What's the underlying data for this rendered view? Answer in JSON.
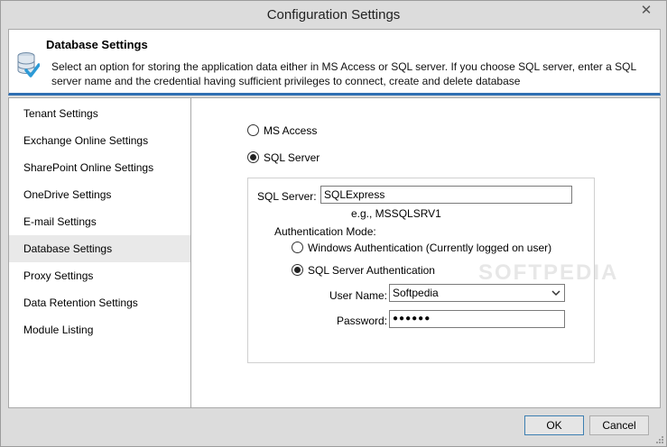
{
  "window": {
    "title": "Configuration Settings",
    "close_glyph": "✕"
  },
  "header": {
    "title": "Database Settings",
    "description": "Select an option for storing the application data either in MS Access or SQL server. If you choose SQL server, enter a SQL server name and the credential having sufficient privileges to connect, create and delete database",
    "icon": "database-check-icon"
  },
  "sidebar": {
    "items": [
      {
        "label": "Tenant Settings",
        "active": false
      },
      {
        "label": "Exchange Online Settings",
        "active": false
      },
      {
        "label": "SharePoint Online Settings",
        "active": false
      },
      {
        "label": "OneDrive Settings",
        "active": false
      },
      {
        "label": "E-mail Settings",
        "active": false
      },
      {
        "label": "Database Settings",
        "active": true
      },
      {
        "label": "Proxy Settings",
        "active": false
      },
      {
        "label": "Data Retention Settings",
        "active": false
      },
      {
        "label": "Module Listing",
        "active": false
      }
    ]
  },
  "storage": {
    "ms_access_label": "MS Access",
    "sql_server_label": "SQL Server",
    "selected": "SQL Server"
  },
  "sql": {
    "server_label": "SQL Server:",
    "server_value": "SQLExpress",
    "server_hint": "e.g., MSSQLSRV1",
    "auth_mode_label": "Authentication Mode:",
    "windows_auth_label": "Windows Authentication (Currently logged on user)",
    "sql_auth_label": "SQL Server Authentication",
    "auth_selected": "SQL Server Authentication",
    "username_label": "User Name:",
    "username_value": "Softpedia",
    "password_label": "Password:",
    "password_value": "●●●●●●"
  },
  "watermark": "SOFTPEDIA",
  "footer": {
    "ok_label": "OK",
    "cancel_label": "Cancel"
  },
  "colors": {
    "accent": "#2f6fb3",
    "selected_item": "#e9e9e9",
    "window_bg": "#dcdcdc"
  }
}
